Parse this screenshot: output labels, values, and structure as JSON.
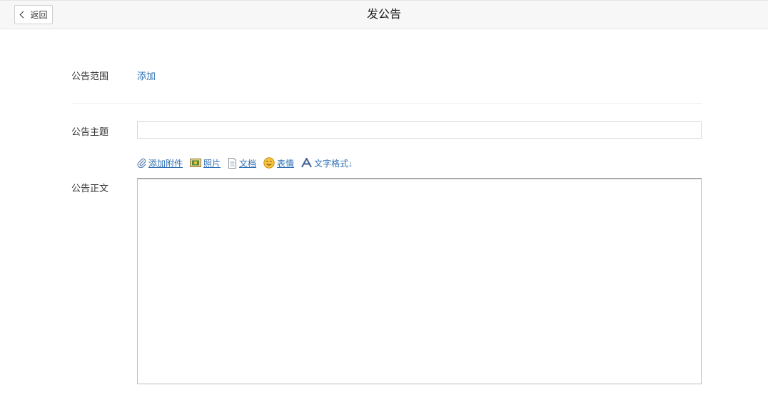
{
  "header": {
    "back_label": "返回",
    "title": "发公告"
  },
  "form": {
    "scope_label": "公告范围",
    "scope_add_link": "添加",
    "subject_label": "公告主题",
    "subject_value": "",
    "body_label": "公告正文",
    "body_value": ""
  },
  "toolbar": {
    "attach": "添加附件",
    "photo": "照片",
    "document": "文档",
    "emoji": "表情",
    "text_format": "文字格式↓"
  },
  "colors": {
    "link": "#2f6fb3",
    "header_bg": "#f7f7f7"
  }
}
